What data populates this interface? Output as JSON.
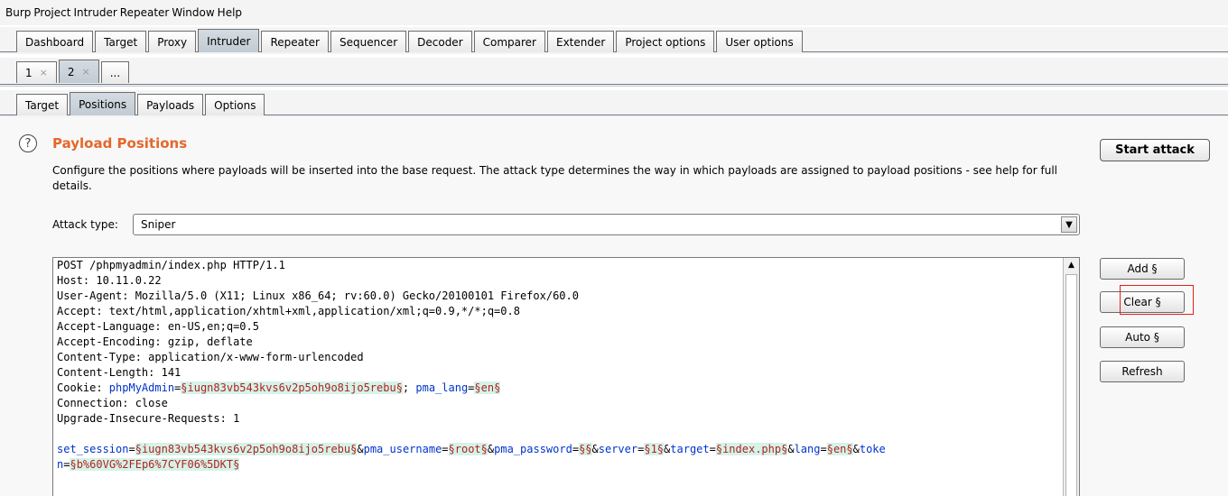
{
  "menu": [
    "Burp",
    "Project",
    "Intruder",
    "Repeater",
    "Window",
    "Help"
  ],
  "main_tabs": [
    "Dashboard",
    "Target",
    "Proxy",
    "Intruder",
    "Repeater",
    "Sequencer",
    "Decoder",
    "Comparer",
    "Extender",
    "Project options",
    "User options"
  ],
  "instance_tabs": [
    {
      "label": "1",
      "close": "×"
    },
    {
      "label": "2",
      "close": "×"
    },
    {
      "label": "...",
      "close": ""
    }
  ],
  "sub_tabs": [
    "Target",
    "Positions",
    "Payloads",
    "Options"
  ],
  "panel": {
    "help_icon": "?",
    "title": "Payload Positions",
    "description": "Configure the positions where payloads will be inserted into the base request. The attack type determines the way in which payloads are assigned to payload positions - see help for full details.",
    "start_attack": "Start attack",
    "attack_type_label": "Attack type:",
    "attack_type_value": "Sniper"
  },
  "request": {
    "line1": "POST /phpmyadmin/index.php HTTP/1.1",
    "line2": "Host: 10.11.0.22",
    "line3": "User-Agent: Mozilla/5.0 (X11; Linux x86_64; rv:60.0) Gecko/20100101 Firefox/60.0",
    "line4": "Accept: text/html,application/xhtml+xml,application/xml;q=0.9,*/*;q=0.8",
    "line5": "Accept-Language: en-US,en;q=0.5",
    "line6": "Accept-Encoding: gzip, deflate",
    "line7": "Content-Type: application/x-www-form-urlencoded",
    "line8": "Content-Length: 141",
    "cookie": {
      "prefix": "Cookie: ",
      "k1": "phpMyAdmin",
      "eq1": "=",
      "v1": "§iugn83vb543kvs6v2p5oh9o8ijo5rebu§",
      "sep1": "; ",
      "k2": "pma_lang",
      "eq2": "=",
      "v2": "§en§"
    },
    "line10": "Connection: close",
    "line11": "Upgrade-Insecure-Requests: 1",
    "body": {
      "k1": "set_session",
      "v1": "§iugn83vb543kvs6v2p5oh9o8ijo5rebu§",
      "k2": "pma_username",
      "v2": "§root§",
      "k3": "pma_password",
      "v3": "§§",
      "k4": "server",
      "v4": "§1§",
      "k5": "target",
      "v5": "§index.php§",
      "k6": "lang",
      "v6": "§en§",
      "k7a": "toke",
      "k7b": "n",
      "v7": "§b%60VG%2FEp6%7CYF06%5DKT§",
      "eq": "=",
      "amp": "&"
    }
  },
  "side_buttons": {
    "add": "Add §",
    "clear": "Clear §",
    "auto": "Auto §",
    "refresh": "Refresh"
  },
  "colors": {
    "title": "#e5672b",
    "param_key": "#0033cc",
    "payload_marker": "#b22222",
    "payload_bg": "#d5f3e8",
    "highlight_box": "#e0201b"
  }
}
